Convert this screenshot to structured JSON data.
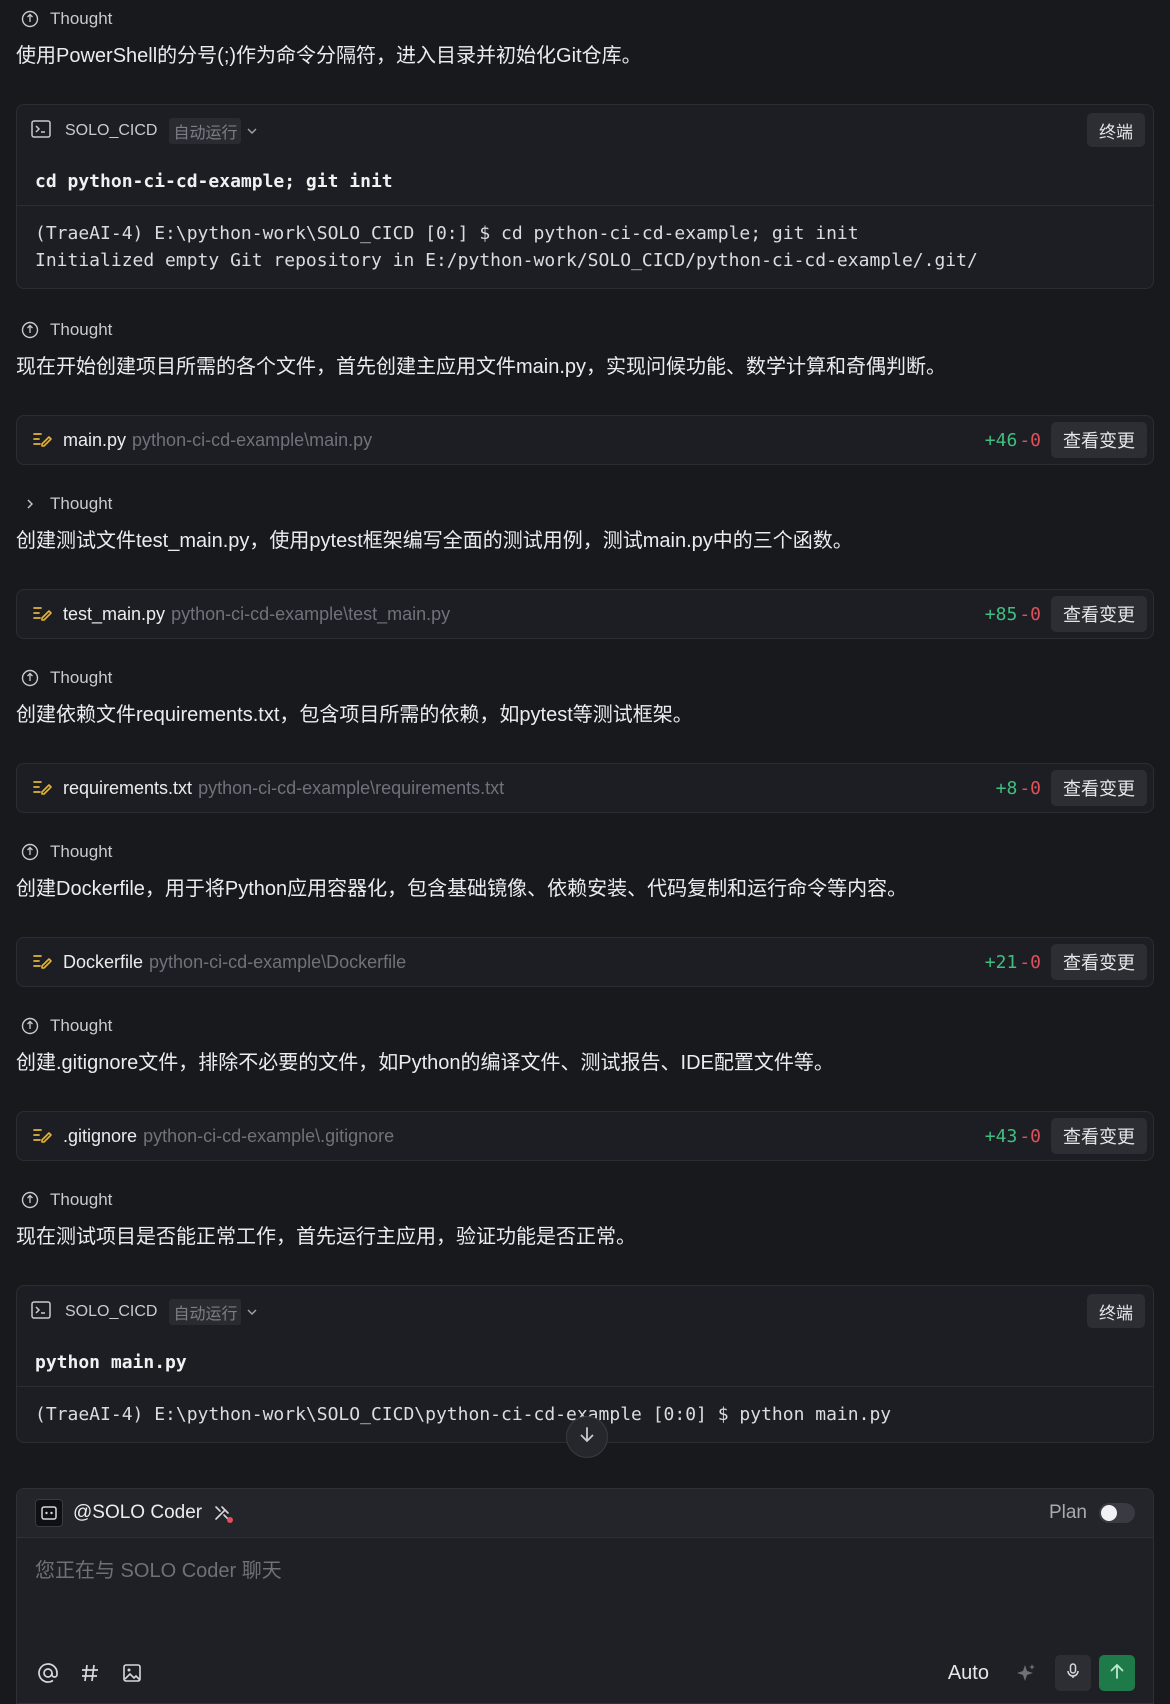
{
  "feed": {
    "thought_label": "Thought",
    "items": [
      {
        "thought": "Thought",
        "message": "使用PowerShell的分号(;)作为命令分隔符，进入目录并初始化Git仓库。"
      },
      {
        "terminal": {
          "name": "SOLO_CICD",
          "badge": "自动运行",
          "button": "终端",
          "command": "cd python-ci-cd-example; git init",
          "output": "(TraeAI-4) E:\\python-work\\SOLO_CICD [0:] $ cd python-ci-cd-example; git init\nInitialized empty Git repository in E:/python-work/SOLO_CICD/python-ci-cd-example/.git/"
        }
      },
      {
        "thought": "Thought",
        "message": "现在开始创建项目所需的各个文件，首先创建主应用文件main.py，实现问候功能、数学计算和奇偶判断。"
      },
      {
        "file": {
          "name": "main.py",
          "path": "python-ci-cd-example\\main.py",
          "adds": "+46",
          "dels": "-0",
          "button": "查看变更"
        }
      },
      {
        "thought": "Thought",
        "message": "创建测试文件test_main.py，使用pytest框架编写全面的测试用例，测试main.py中的三个函数。"
      },
      {
        "file": {
          "name": "test_main.py",
          "path": "python-ci-cd-example\\test_main.py",
          "adds": "+85",
          "dels": "-0",
          "button": "查看变更"
        }
      },
      {
        "thought": "Thought",
        "message": "创建依赖文件requirements.txt，包含项目所需的依赖，如pytest等测试框架。"
      },
      {
        "file": {
          "name": "requirements.txt",
          "path": "python-ci-cd-example\\requirements.txt",
          "adds": "+8",
          "dels": "-0",
          "button": "查看变更"
        }
      },
      {
        "thought": "Thought",
        "message": "创建Dockerfile，用于将Python应用容器化，包含基础镜像、依赖安装、代码复制和运行命令等内容。"
      },
      {
        "file": {
          "name": "Dockerfile",
          "path": "python-ci-cd-example\\Dockerfile",
          "adds": "+21",
          "dels": "-0",
          "button": "查看变更"
        }
      },
      {
        "thought": "Thought",
        "message": "创建.gitignore文件，排除不必要的文件，如Python的编译文件、测试报告、IDE配置文件等。"
      },
      {
        "file": {
          "name": ".gitignore",
          "path": "python-ci-cd-example\\.gitignore",
          "adds": "+43",
          "dels": "-0",
          "button": "查看变更"
        }
      },
      {
        "thought": "Thought",
        "message": "现在测试项目是否能正常工作，首先运行主应用，验证功能是否正常。"
      },
      {
        "terminal": {
          "name": "SOLO_CICD",
          "badge": "自动运行",
          "button": "终端",
          "command": "python main.py",
          "output": "(TraeAI-4) E:\\python-work\\SOLO_CICD\\python-ci-cd-example [0:0] $ python main.py"
        }
      }
    ]
  },
  "composer": {
    "agent": "@SOLO Coder",
    "plan_label": "Plan",
    "placeholder": "您正在与 SOLO Coder 聊天",
    "auto_label": "Auto"
  },
  "icons": {
    "thought": "bulb-icon",
    "terminal": "terminal-icon",
    "file_edit": "file-edit-icon",
    "scroll_down": "arrow-down-icon",
    "at": "at-icon",
    "hash": "hash-icon",
    "image": "image-icon",
    "sparkle": "sparkle-icon",
    "mic": "mic-icon",
    "send": "arrow-up-icon"
  },
  "colors": {
    "background": "#18191d",
    "added": "#3fbf7f",
    "removed": "#e0505a",
    "send": "#1f7a4a",
    "file_icon": "#e2b33c"
  }
}
